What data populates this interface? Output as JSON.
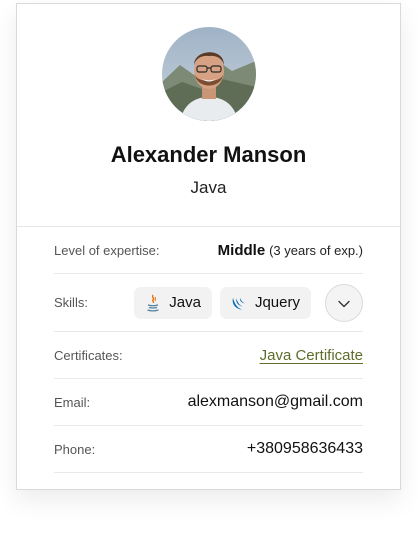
{
  "profile": {
    "name": "Alexander Manson",
    "role": "Java"
  },
  "details": {
    "expertise": {
      "label": "Level of expertise:",
      "level": "Middle",
      "years": "(3 years of exp.)"
    },
    "skills": {
      "label": "Skills:",
      "items": [
        {
          "label": "Java",
          "icon": "java-icon"
        },
        {
          "label": "Jquery",
          "icon": "jquery-icon"
        }
      ],
      "expand_icon": "chevron-down-icon"
    },
    "certificates": {
      "label": "Certificates:",
      "link": "Java Certificate",
      "link_color": "#5e6d2a"
    },
    "email": {
      "label": "Email:",
      "value": "alexmanson@gmail.com"
    },
    "phone": {
      "label": "Phone:",
      "value": "+380958636433"
    }
  }
}
